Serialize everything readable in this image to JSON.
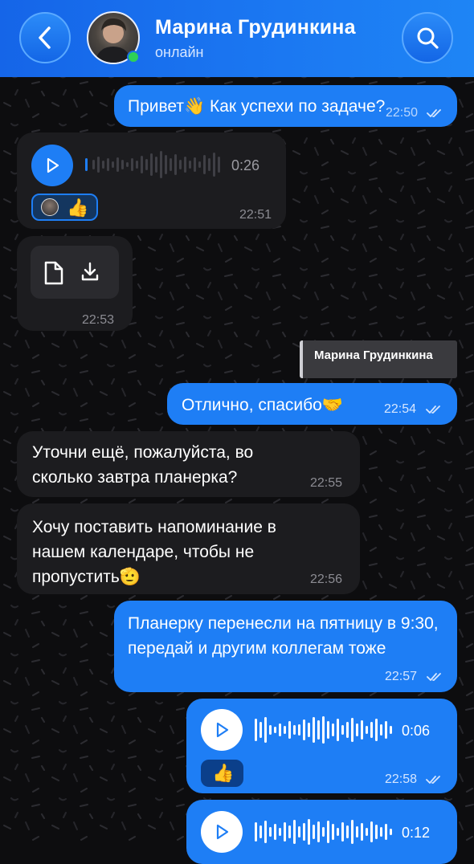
{
  "header": {
    "contact_name": "Марина Грудинкина",
    "status": "онлайн",
    "online_color": "#2ed158"
  },
  "icons": {
    "back": "chevron-left-icon",
    "search": "search-icon",
    "file": "file-icon",
    "download": "download-icon",
    "play": "play-icon",
    "read": "double-check-icon"
  },
  "messages": [
    {
      "direction": "out",
      "type": "text",
      "text": "Привет👋 Как успехи по задаче?",
      "time": "22:50",
      "read": true
    },
    {
      "direction": "in",
      "type": "voice",
      "duration": "0:26",
      "time": "22:51",
      "reaction": "👍"
    },
    {
      "direction": "in",
      "type": "file",
      "time": "22:53"
    },
    {
      "direction": "out",
      "type": "text",
      "reply_to": "Марина Грудинкина",
      "text": "Отлично, спасибо🤝",
      "time": "22:54",
      "read": true
    },
    {
      "direction": "in",
      "type": "text",
      "text": "Уточни ещё, пожалуйста, во сколько завтра планерка?",
      "time": "22:55"
    },
    {
      "direction": "in",
      "type": "text",
      "text": "Хочу поставить напоминание в нашем календаре, чтобы не пропустить🫡",
      "time": "22:56"
    },
    {
      "direction": "out",
      "type": "text",
      "text": "Планерку перенесли на пятницу в 9:30, передай и другим коллегам тоже",
      "time": "22:57",
      "read": true
    },
    {
      "direction": "out",
      "type": "voice",
      "duration": "0:06",
      "time": "22:58",
      "reaction": "👍",
      "read": true
    },
    {
      "direction": "out",
      "type": "voice",
      "duration": "0:12"
    }
  ],
  "colors": {
    "accent": "#1e7ef5",
    "incoming_bubble": "#1c1c1f",
    "background": "#0d0d0f"
  }
}
